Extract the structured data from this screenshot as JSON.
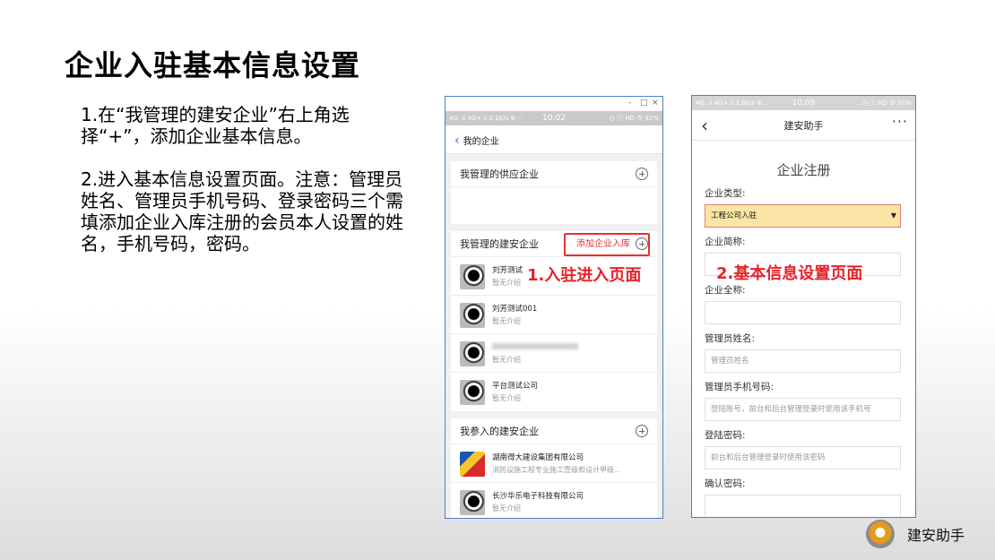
{
  "slide": {
    "title": "企业入驻基本信息设置",
    "para1": "1.在“我管理的建安企业”右上角选择“+”，添加企业基本信息。",
    "para2": "2.进入基本信息设置页面。注意：管理员姓名、管理员手机号码、登录密码三个需填添加企业入库注册的会员本人设置的姓名，手机号码，密码。",
    "brand": "建安助手"
  },
  "phone1": {
    "window_controls": [
      "-",
      "□",
      "×"
    ],
    "status_left": "4G .ıl 4G+.ıl 0.1K/s ⊕ ···",
    "status_time": "10:02",
    "status_right": "◷ ⓘ HD 令 92%",
    "nav_title": "我的企业",
    "sections": [
      {
        "title": "我管理的供应企业"
      },
      {
        "title": "我管理的建安企业",
        "add_label": "添加企业入库"
      },
      {
        "title": "我参入的建安企业"
      }
    ],
    "managed_items": [
      {
        "name": "刘芳测试",
        "sub": "暂无介绍"
      },
      {
        "name": "刘芳测试001",
        "sub": "暂无介绍"
      },
      {
        "name": "",
        "sub": "暂无介绍"
      },
      {
        "name": "平台测试公司",
        "sub": "暂无介绍"
      }
    ],
    "joined_items": [
      {
        "name": "湖南得大建设集团有限公司",
        "sub": "消防设施工程专业施工壹级和设计甲级..."
      },
      {
        "name": "长沙华乐电子科技有限公司",
        "sub": "暂无介绍"
      }
    ],
    "callout": "1.入驻进入页面"
  },
  "phone2": {
    "status_left": "4G .ıl 4G+.ıl 2.8K/s ⊕",
    "status_time": "10:09",
    "status_right": "◷ ⓘ HD 令 91%",
    "nav_title": "建安助手",
    "more": "···",
    "form_title": "企业注册",
    "callout": "2.基本信息设置页面",
    "fields": [
      {
        "label": "企业类型:",
        "value": "工程公司入驻",
        "placeholder": ""
      },
      {
        "label": "企业简称:",
        "value": "",
        "placeholder": ""
      },
      {
        "label": "企业全称:",
        "value": "",
        "placeholder": ""
      },
      {
        "label": "管理员姓名:",
        "value": "",
        "placeholder": "管理员姓名"
      },
      {
        "label": "管理员手机号码:",
        "value": "",
        "placeholder": "登陆账号，前台和后台管理登录时使用该手机号"
      },
      {
        "label": "登陆密码:",
        "value": "",
        "placeholder": "前台和后台管理登录时使用该密码"
      },
      {
        "label": "确认密码:",
        "value": "",
        "placeholder": ""
      }
    ]
  },
  "colors": {
    "accent_blue": "#2a6fd1",
    "callout_red": "#e5232a",
    "select_bg": "#fbe5a6"
  }
}
